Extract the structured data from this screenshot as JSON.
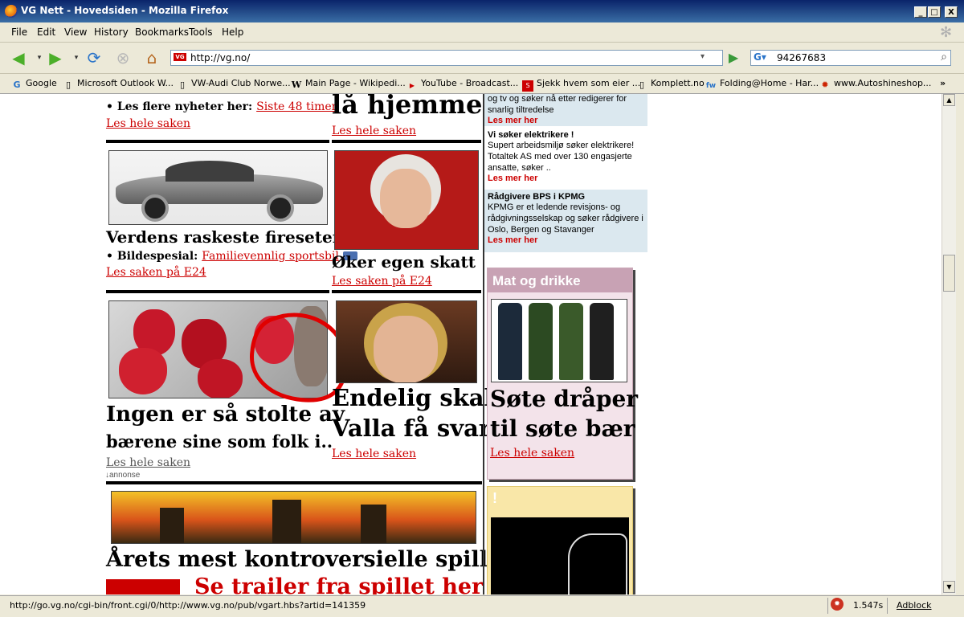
{
  "window": {
    "title": "VG Nett - Hovedsiden - Mozilla Firefox",
    "min": "_",
    "max": "□",
    "close": "X"
  },
  "menu": {
    "file": "File",
    "edit": "Edit",
    "view": "View",
    "history": "History",
    "bookmarks": "Bookmarks",
    "tools": "Tools",
    "help": "Help"
  },
  "nav": {
    "url": "http://vg.no/",
    "search_value": "94267683",
    "favicon_text": "VG"
  },
  "bookmarks": [
    "Google",
    "Microsoft Outlook W...",
    "VW-Audi Club Norwe...",
    "Main Page - Wikipedi...",
    "YouTube - Broadcast...",
    "Sjekk hvem som eier ...",
    "Komplett.no",
    "Folding@Home - Har...",
    "www.Autoshineshop..."
  ],
  "bookmarks_more": "»",
  "col1": {
    "news_prefix": "• Les flere nyheter her: ",
    "news_link": "Siste 48 timer",
    "read1": "Les hele saken",
    "car_title": "Verdens raskeste fireseter",
    "bilde_prefix": "• Bildespesial: ",
    "bilde_link": "Familievennlig sportsbil",
    "car_read": "Les saken på E24",
    "straw_title1": "Ingen er så stolte av",
    "straw_title2": "bærene sine som folk i..",
    "straw_read": "Les hele saken",
    "annonse": "annonse",
    "game_title": "Årets mest kontroversielle spill?",
    "trailer": "Se trailer fra spillet her"
  },
  "col2": {
    "top_title": "lå hjemme",
    "read1": "Les hele saken",
    "tax_title": "Øker egen skatt",
    "tax_read": "Les saken på E24",
    "valla_title1": "Endelig skal",
    "valla_title2": "Valla få svar",
    "valla_read": "Les hele saken"
  },
  "jobs": [
    {
      "title": "",
      "text": "og tv og søker nå etter redigerer for snarlig tiltredelse",
      "more": "Les mer her"
    },
    {
      "title": "Vi søker elektrikere !",
      "text": "Supert arbeidsmiljø søker elektrikere! Totaltek AS med over 130 engasjerte ansatte, søker ..",
      "more": "Les mer her"
    },
    {
      "title": "Rådgivere BPS i KPMG",
      "text": "KPMG er et ledende revisjons- og rådgivningsselskap og søker rådgivere i Oslo, Bergen og Stavanger",
      "more": "Les mer her"
    }
  ],
  "mat": {
    "header": "Mat og drikke",
    "title1": "Søte dråper",
    "title2": "til søte bær",
    "read": "Les hele saken"
  },
  "promo": {
    "header": "!"
  },
  "status": {
    "url": "http://go.vg.no/cgi-bin/front.cgi/0/http://www.vg.no/pub/vgart.hbs?artid=141359",
    "time": "1.547s",
    "adblock": "Adblock"
  }
}
